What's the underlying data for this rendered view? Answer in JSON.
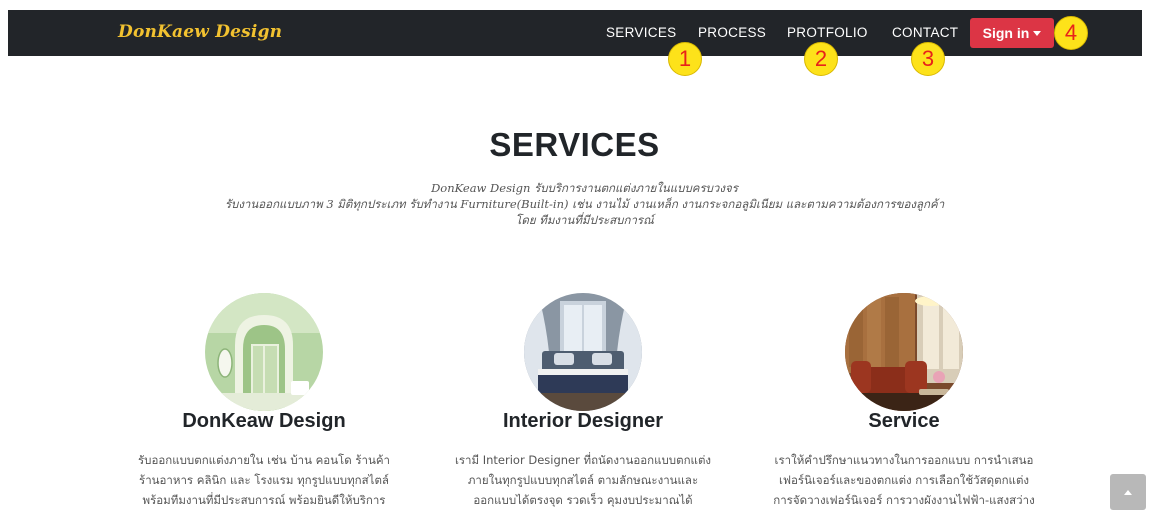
{
  "navbar": {
    "brand": "DonKaew Design",
    "links": [
      "SERVICES",
      "PROCESS",
      "PROTFOLIO",
      "CONTACT"
    ],
    "signin_label": "Sign in",
    "colors": {
      "background": "#222529",
      "brand": "#f2c230",
      "signin": "#dc3545"
    }
  },
  "callouts": [
    "1",
    "2",
    "3",
    "4"
  ],
  "services": {
    "title": "SERVICES",
    "intro_lines": [
      "DonKeaw Design   รับบริการงานตกแต่งภายในแบบครบวงจร",
      "รับงานออกแบบภาพ 3 มิติทุกประเภท รับทำงาน Furniture(Built-in) เช่น งานไม้ งานเหล็ก งานกระจกอลูมิเนียม และตามความต้องการของลูกค้า",
      "โดย ทีมงานที่มีประสบการณ์"
    ],
    "cards": [
      {
        "image": "green-interior-photo",
        "title": "DonKeaw Design",
        "lines": [
          "รับออกแบบตกแต่งภายใน เช่น บ้าน คอนโด ร้านค้า",
          "ร้านอาหาร คลินิก และ โรงแรม ทุกรูปแบบทุกสไตล์",
          "พร้อมทีมงานที่มีประสบการณ์ พร้อมยินดีให้บริการ"
        ]
      },
      {
        "image": "bedroom-interior-photo",
        "title": "Interior Designer",
        "lines": [
          "เรามี Interior Designer ที่ถนัดงานออกแบบตกแต่ง",
          "ภายในทุกรูปแบบทุกสไตล์ ตามลักษณะงานและ",
          "ออกแบบได้ตรงจุด รวดเร็ว คุมงบประมาณได้"
        ]
      },
      {
        "image": "living-room-photo",
        "title": "Service",
        "lines": [
          "เราให้คำปรึกษาแนวทางในการออกแบบ การนำเสนอ",
          "เฟอร์นิเจอร์และของตกแต่ง การเลือกใช้วัสดุตกแต่ง",
          "การจัดวางเฟอร์นิเจอร์ การวางผังงานไฟฟ้า-แสงสว่าง"
        ]
      }
    ]
  },
  "back_to_top_icon": "chevron-up-icon"
}
